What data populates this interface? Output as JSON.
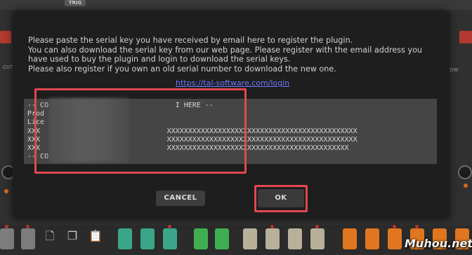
{
  "background": {
    "trig_label": "TRIG",
    "side_left_label": "CUT",
    "side_right_label": "OW"
  },
  "dialog": {
    "message_lines": [
      "Please paste the serial key you have received by email here to register the plugin.",
      "You can also download the serial key from our web page. Please register with the email address you",
      "have used to buy the plugin and login to download the serial keys.",
      "Please also register if you own an old serial number to download the new one."
    ],
    "link": "https://tal-software.com/login",
    "serial_lines": [
      "-- CO                              I HERE --",
      "Prod",
      "Lice",
      "XXX                              XXXXXXXXXXXXXXXXXXXXXXXXXXXXXXXXXXXXXXXXXXXXX",
      "XXX                              XXXXXXXXXXXXXXXXXXXXXXXXXXXXXXXXXXXXXXXXXXXXX",
      "XXX                              XXXXXXXXXXXXXXXXXXXXXXXXXXXXXXXXXXXXXXXXXXX",
      "-- CO"
    ],
    "cancel_label": "CANCEL",
    "ok_label": "OK"
  },
  "watermark": "Muhou.net",
  "colors": {
    "highlight": "#e0484f",
    "link": "#6e78ff",
    "modal_bg": "#1e1e1e",
    "serial_bg": "#454545"
  }
}
